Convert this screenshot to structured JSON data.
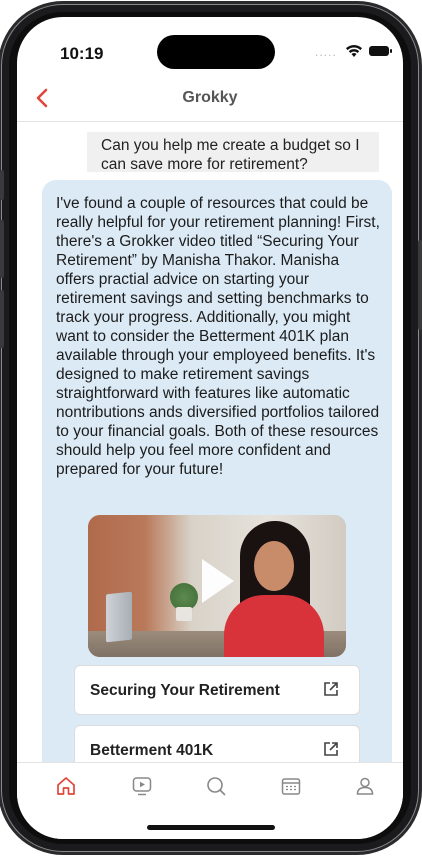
{
  "status_bar": {
    "time": "10:19",
    "carrier": "....."
  },
  "header": {
    "title": "Grokky"
  },
  "chat": {
    "user_message": "Can you help me create a budget so I can save more for retirement?",
    "assistant_message": "I've found a couple of resources that could be really helpful for your retirement planning! First, there's a Grokker video titled “Securing Your Retirement” by Manisha Thakor. Manisha offers practial advice on starting your retirement savings and setting benchmarks to track your progress. Additionally, you might want to consider the Betterment 401K plan available through your employeed benefits. It's designed to make retirement savings straightforward with features like automatic nontributions ands diversified portfolios tailored to your financial goals. Both of these resources should help you feel more confident and prepared for your future!",
    "links": [
      {
        "label": "Securing Your Retirement"
      },
      {
        "label": "Betterment 401K"
      }
    ]
  },
  "tab_bar": {
    "items": [
      {
        "icon": "home-icon",
        "active": true
      },
      {
        "icon": "video-icon",
        "active": false
      },
      {
        "icon": "search-icon",
        "active": false
      },
      {
        "icon": "calendar-icon",
        "active": false
      },
      {
        "icon": "profile-icon",
        "active": false
      }
    ]
  },
  "colors": {
    "accent": "#e0463a",
    "assistant_bubble": "#dbeaf5",
    "user_bubble": "#f0f0f0"
  }
}
